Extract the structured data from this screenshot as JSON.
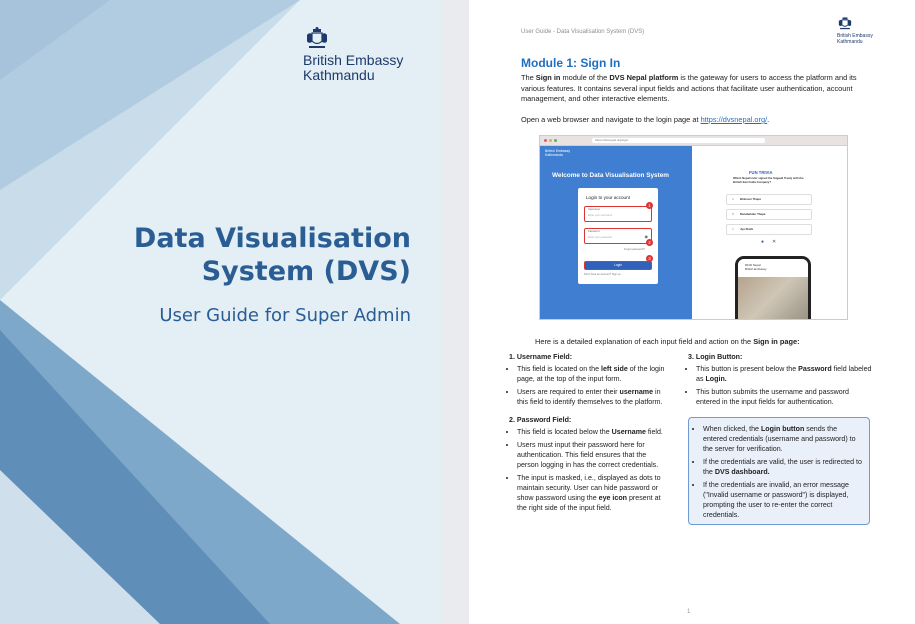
{
  "cover": {
    "embassy_line1": "British Embassy",
    "embassy_line2": "Kathmandu",
    "title_line1": "Data Visualisation",
    "title_line2": "System (DVS)",
    "subtitle": "User Guide for Super Admin"
  },
  "page": {
    "header": "User Guide - Data Visualisation System (DVS)",
    "header_embassy_line1": "British Embassy",
    "header_embassy_line2": "Kathmandu",
    "module_title": "Module 1: Sign In",
    "intro_pre1": "The ",
    "intro_b1": "Sign in",
    "intro_pre2": " module of the ",
    "intro_b2": "DVS Nepal platform",
    "intro_rest": " is the gateway for users to access the platform and its various features. It contains several input fields and actions that facilitate user authentication, account management, and other interactive elements.",
    "open_text": "Open a web browser and navigate to the login page at ",
    "open_link": "https://dvsnepal.org/",
    "open_end": ".",
    "screenshot": {
      "url": "https://dvsnepal.org/login",
      "mini_line1": "British Embassy",
      "mini_line2": "Kathmandu",
      "welcome": "Welcome to Data Visualisation System",
      "card_title": "Login to your account",
      "username_label": "Username",
      "username_placeholder": "Enter your username",
      "password_label": "Password",
      "password_placeholder": "Enter your password",
      "forgot": "Forgot password?",
      "login_button": "Login",
      "register": "Don't have an account? Sign up",
      "badge1": "1",
      "badge2": "2",
      "badge3": "3",
      "trivia_title": "FUN TRIVIA",
      "trivia_question": "Which Nepali ruler signed the Sugauli Treaty with the British East India Company?",
      "options": [
        "Bhimsen Thapa",
        "Ranabahdur Thapa",
        "Jya Shahi"
      ],
      "opt_letters": [
        "A",
        "B",
        "C"
      ],
      "phone_caption1": "DFID Nepal",
      "phone_caption2": "British Embassy"
    },
    "section_intro_pre": "Here is a detailed explanation of each input field and action on the ",
    "section_intro_b": "Sign in page:",
    "username_heading": "1. Username Field:",
    "u1_pre": "This field is located on the ",
    "u1_b": "left side",
    "u1_rest": " of the login page, at the top of the input form.",
    "u2_pre": "Users are required to enter their ",
    "u2_b": "username",
    "u2_rest": " in this field to identify themselves to the platform.",
    "password_heading": "2. Password Field:",
    "p1_pre": "This field is located below the ",
    "p1_b": "Username",
    "p1_rest": " field.",
    "p2": "Users must input their password here for authentication. This field ensures that the person logging in has the correct credentials.",
    "p3_pre": "The input is masked, i.e., displayed as dots to maintain security. User can hide password or show password using the ",
    "p3_b": "eye icon",
    "p3_rest": " present at the right side of the input field.",
    "login_heading": "3. Login Button:",
    "l1_pre": "This button is present below the ",
    "l1_b": "Password",
    "l1_mid": " field labeled as ",
    "l1_b2": "Login.",
    "l2": "This button submits the username and password entered in the input fields for authentication.",
    "n1_pre": "When clicked, the ",
    "n1_b": "Login button",
    "n1_rest": " sends the entered credentials (username and password) to the server for verification.",
    "n2_pre": "If the credentials are valid, the user is redirected to the ",
    "n2_b": "DVS dashboard.",
    "n3": "If the credentials are invalid, an error message (\"Invalid username or password\") is displayed, prompting the user to re-enter the correct credentials.",
    "page_number": "1"
  },
  "colors": {
    "title_blue": "#2a5d93",
    "accent_blue": "#1f6fc0",
    "note_border": "#6f9ad2",
    "badge_red": "#d33333"
  }
}
